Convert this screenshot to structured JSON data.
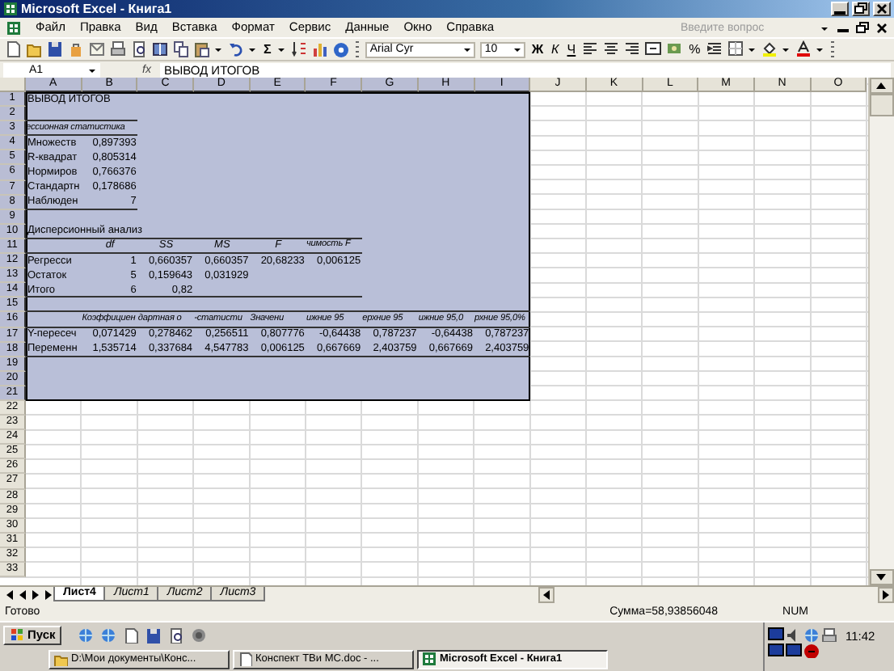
{
  "window": {
    "title": "Microsoft Excel - Книга1"
  },
  "menu": [
    {
      "label": "Файл"
    },
    {
      "label": "Правка"
    },
    {
      "label": "Вид"
    },
    {
      "label": "Вставка"
    },
    {
      "label": "Формат"
    },
    {
      "label": "Сервис"
    },
    {
      "label": "Данные"
    },
    {
      "label": "Окно"
    },
    {
      "label": "Справка"
    }
  ],
  "help_search": {
    "placeholder": "Введите вопрос"
  },
  "toolbar": {
    "sum": "Σ",
    "font": "Arial Cyr",
    "size": "10",
    "styles": [
      "Ж",
      "К",
      "Ч"
    ],
    "percent": "%"
  },
  "formula_bar": {
    "name_box": "A1",
    "function_label": "fx",
    "formula": "ВЫВОД ИТОГОВ"
  },
  "sheet": {
    "columns": [
      {
        "label": "A",
        "selected": true
      },
      {
        "label": "B",
        "selected": true
      },
      {
        "label": "C",
        "selected": true
      },
      {
        "label": "D",
        "selected": true
      },
      {
        "label": "E",
        "selected": true
      },
      {
        "label": "F",
        "selected": true
      },
      {
        "label": "G",
        "selected": true
      },
      {
        "label": "H",
        "selected": true
      },
      {
        "label": "I",
        "selected": true
      },
      {
        "label": "J",
        "selected": false
      },
      {
        "label": "K",
        "selected": false
      },
      {
        "label": "L",
        "selected": false
      },
      {
        "label": "M",
        "selected": false
      },
      {
        "label": "N",
        "selected": false
      },
      {
        "label": "O",
        "selected": false
      }
    ],
    "rows": [
      {
        "label": "1",
        "selected": true,
        "cells": {
          "a": {
            "text": "ВЫВОД ИТОГОВ",
            "kind": "text"
          }
        }
      },
      {
        "label": "2",
        "selected": true,
        "kind": "short_rule",
        "cells": {}
      },
      {
        "label": "3",
        "selected": true,
        "kind": "short_rule",
        "cells": {
          "a": {
            "text": "ессионная статистика",
            "kind": "caption"
          }
        }
      },
      {
        "label": "4",
        "selected": true,
        "cells": {
          "a": {
            "text": "Множеств",
            "kind": "text"
          },
          "b": {
            "text": "0,897393",
            "kind": "number"
          }
        }
      },
      {
        "label": "5",
        "selected": true,
        "cells": {
          "a": {
            "text": "R-квадрат",
            "kind": "text"
          },
          "b": {
            "text": "0,805314",
            "kind": "number"
          }
        }
      },
      {
        "label": "6",
        "selected": true,
        "cells": {
          "a": {
            "text": "Нормиров",
            "kind": "text"
          },
          "b": {
            "text": "0,766376",
            "kind": "number"
          }
        }
      },
      {
        "label": "7",
        "selected": true,
        "cells": {
          "a": {
            "text": "Стандартн",
            "kind": "text"
          },
          "b": {
            "text": "0,178686",
            "kind": "number"
          }
        }
      },
      {
        "label": "8",
        "selected": true,
        "kind": "short_rule",
        "cells": {
          "a": {
            "text": "Наблюден",
            "kind": "text"
          },
          "b": {
            "text": "7",
            "kind": "number"
          }
        }
      },
      {
        "label": "9",
        "selected": true,
        "cells": {}
      },
      {
        "label": "10",
        "selected": true,
        "kind": "table_rule",
        "cells": {
          "a": {
            "text": "Дисперсионный анализ",
            "kind": "text"
          }
        }
      },
      {
        "label": "11",
        "selected": true,
        "kind": "table_rule",
        "cells": {
          "b": {
            "text": "df",
            "kind": "header"
          },
          "c": {
            "text": "SS",
            "kind": "header"
          },
          "d": {
            "text": "MS",
            "kind": "header"
          },
          "e": {
            "text": "F",
            "kind": "header"
          },
          "f": {
            "text": "чимость F",
            "kind": "caption"
          }
        }
      },
      {
        "label": "12",
        "selected": true,
        "cells": {
          "a": {
            "text": "Регресси",
            "kind": "text"
          },
          "b": {
            "text": "1",
            "kind": "number"
          },
          "c": {
            "text": "0,660357",
            "kind": "number"
          },
          "d": {
            "text": "0,660357",
            "kind": "number"
          },
          "e": {
            "text": "20,68233",
            "kind": "number"
          },
          "f": {
            "text": "0,006125",
            "kind": "number"
          }
        }
      },
      {
        "label": "13",
        "selected": true,
        "cells": {
          "a": {
            "text": "Остаток",
            "kind": "text"
          },
          "b": {
            "text": "5",
            "kind": "number"
          },
          "c": {
            "text": "0,159643",
            "kind": "number"
          },
          "d": {
            "text": "0,031929",
            "kind": "number"
          }
        }
      },
      {
        "label": "14",
        "selected": true,
        "kind": "table_rule",
        "cells": {
          "a": {
            "text": "Итого",
            "kind": "text"
          },
          "b": {
            "text": "6",
            "kind": "number"
          },
          "c": {
            "text": "0,82",
            "kind": "number"
          }
        }
      },
      {
        "label": "15",
        "selected": true,
        "kind": "wide_rule",
        "cells": {}
      },
      {
        "label": "16",
        "selected": true,
        "kind": "wide_rule",
        "cells": {
          "b": {
            "text": "Коэффициен",
            "kind": "caption"
          },
          "c": {
            "text": "дартная о",
            "kind": "caption"
          },
          "d": {
            "text": "-статисти",
            "kind": "caption"
          },
          "e": {
            "text": "Значени",
            "kind": "caption"
          },
          "f": {
            "text": "ижние 95",
            "kind": "caption"
          },
          "g": {
            "text": "ерхние 95",
            "kind": "caption"
          },
          "h": {
            "text": "ижние 95,0",
            "kind": "caption"
          },
          "i": {
            "text": "рхние 95,0%",
            "kind": "caption"
          }
        }
      },
      {
        "label": "17",
        "selected": true,
        "cells": {
          "a": {
            "text": "Y-пересеч",
            "kind": "text"
          },
          "b": {
            "text": "0,071429",
            "kind": "number"
          },
          "c": {
            "text": "0,278462",
            "kind": "number"
          },
          "d": {
            "text": "0,256511",
            "kind": "number"
          },
          "e": {
            "text": "0,807776",
            "kind": "number"
          },
          "f": {
            "text": "-0,64438",
            "kind": "number"
          },
          "g": {
            "text": "0,787237",
            "kind": "number"
          },
          "h": {
            "text": "-0,64438",
            "kind": "number"
          },
          "i": {
            "text": "0,787237",
            "kind": "number"
          }
        }
      },
      {
        "label": "18",
        "selected": true,
        "kind": "wide_rule",
        "cells": {
          "a": {
            "text": "Переменн",
            "kind": "text"
          },
          "b": {
            "text": "1,535714",
            "kind": "number"
          },
          "c": {
            "text": "0,337684",
            "kind": "number"
          },
          "d": {
            "text": "4,547783",
            "kind": "number"
          },
          "e": {
            "text": "0,006125",
            "kind": "number"
          },
          "f": {
            "text": "0,667669",
            "kind": "number"
          },
          "g": {
            "text": "2,403759",
            "kind": "number"
          },
          "h": {
            "text": "0,667669",
            "kind": "number"
          },
          "i": {
            "text": "2,403759",
            "kind": "number"
          }
        }
      },
      {
        "label": "19",
        "selected": true,
        "cells": {}
      },
      {
        "label": "20",
        "selected": true,
        "cells": {}
      },
      {
        "label": "21",
        "selected": true,
        "cells": {}
      },
      {
        "label": "22",
        "selected": false,
        "cells": {}
      },
      {
        "label": "23",
        "selected": false,
        "cells": {}
      },
      {
        "label": "24",
        "selected": false,
        "cells": {}
      },
      {
        "label": "25",
        "selected": false,
        "cells": {}
      },
      {
        "label": "26",
        "selected": false,
        "cells": {}
      },
      {
        "label": "27",
        "selected": false,
        "cells": {}
      },
      {
        "label": "28",
        "selected": false,
        "cells": {}
      },
      {
        "label": "29",
        "selected": false,
        "cells": {}
      },
      {
        "label": "30",
        "selected": false,
        "cells": {}
      },
      {
        "label": "31",
        "selected": false,
        "cells": {}
      },
      {
        "label": "32",
        "selected": false,
        "cells": {}
      },
      {
        "label": "33",
        "selected": false,
        "cells": {}
      }
    ]
  },
  "sheet_tabs": [
    {
      "label": "Лист4",
      "selected": true
    },
    {
      "label": "Лист1",
      "selected": false
    },
    {
      "label": "Лист2",
      "selected": false
    },
    {
      "label": "Лист3",
      "selected": false
    }
  ],
  "status_bar": {
    "state": "Готово",
    "sum": "Сумма=58,93856048",
    "mode": "NUM"
  },
  "taskbar": {
    "start": "Пуск",
    "tasks": [
      {
        "label": "D:\\Мои документы\\Конс...",
        "selected": false,
        "kind": "folder"
      },
      {
        "label": "Конспект ТВи МС.doc - ...",
        "selected": false,
        "kind": "document"
      },
      {
        "label": "Microsoft Excel - Книга1",
        "selected": true,
        "kind": "spreadsheet"
      }
    ],
    "clock": "11:42"
  }
}
